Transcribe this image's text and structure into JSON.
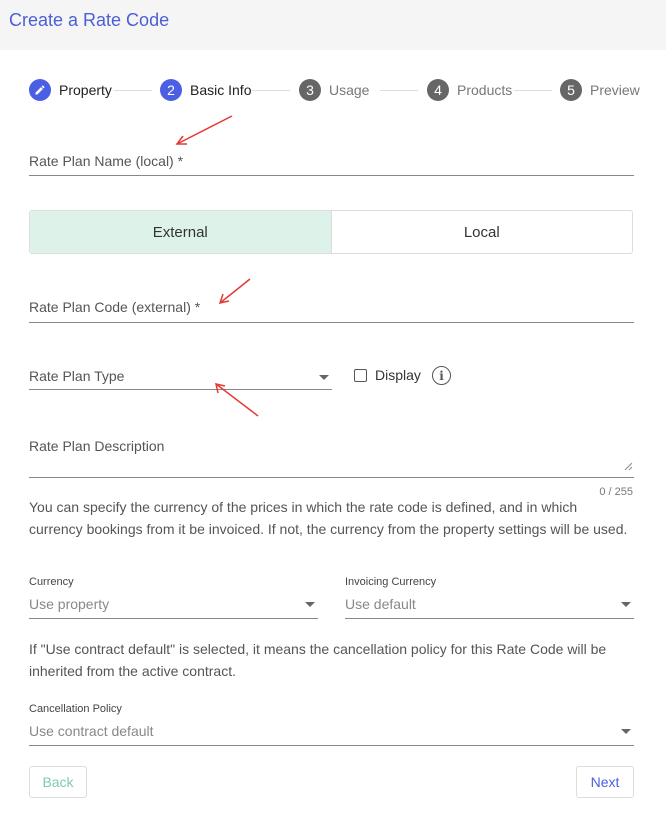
{
  "page": {
    "title": "Create a Rate Code"
  },
  "stepper": {
    "steps": [
      {
        "number": "",
        "label": "Property",
        "state": "completed"
      },
      {
        "number": "2",
        "label": "Basic Info",
        "state": "active"
      },
      {
        "number": "3",
        "label": "Usage",
        "state": "inactive"
      },
      {
        "number": "4",
        "label": "Products",
        "state": "inactive"
      },
      {
        "number": "5",
        "label": "Preview",
        "state": "inactive"
      }
    ]
  },
  "form": {
    "rate_plan_name_label": "Rate Plan Name (local) *",
    "source_toggle": {
      "options": [
        "External",
        "Local"
      ],
      "selected": "External"
    },
    "rate_plan_code_label": "Rate Plan Code (external) *",
    "rate_plan_type_label": "Rate Plan Type",
    "display_label": "Display",
    "display_checked": false,
    "description_label": "Rate Plan Description",
    "description_counter": "0 / 255",
    "currency_help": "You can specify the currency of the prices in which the rate code is defined, and in which currency bookings from it be invoiced. If not, the currency from the property settings will be used.",
    "currency_label": "Currency",
    "currency_value": "Use property",
    "invoicing_currency_label": "Invoicing Currency",
    "invoicing_currency_value": "Use default",
    "cancellation_help": "If \"Use contract default\" is selected, it means the cancellation policy for this Rate Code will be inherited from the active contract.",
    "cancellation_label": "Cancellation Policy",
    "cancellation_value": "Use contract default"
  },
  "actions": {
    "back_label": "Back",
    "next_label": "Next"
  },
  "colors": {
    "accent": "#4a5fe3",
    "selected_toggle": "#ddf3ea",
    "annotation": "#e53935"
  }
}
